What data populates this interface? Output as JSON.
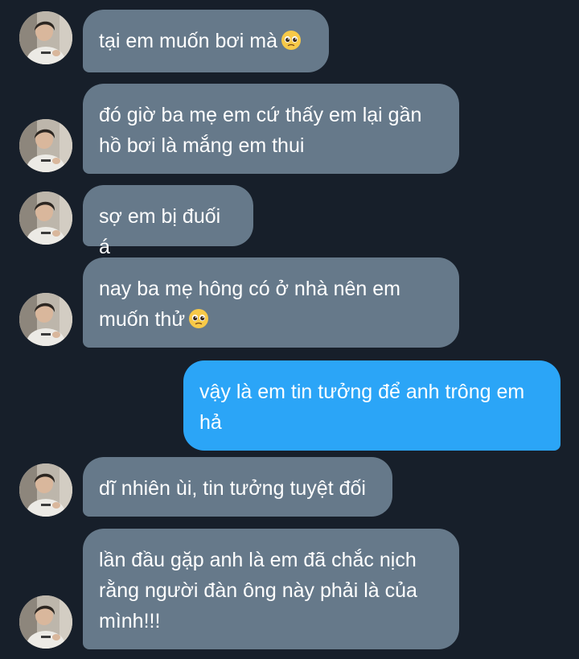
{
  "messages": [
    {
      "id": "m1",
      "direction": "incoming",
      "text": "tại em muốn bơi mà",
      "emoji": "pleading-face-emoji"
    },
    {
      "id": "m2",
      "direction": "incoming",
      "text": "đó giờ ba mẹ em cứ thấy em lại gần hồ bơi là mắng em thui"
    },
    {
      "id": "m3",
      "direction": "incoming",
      "text": "sợ em bị đuối á"
    },
    {
      "id": "m4",
      "direction": "incoming",
      "text": "nay ba mẹ hông có ở nhà nên em muốn thử",
      "emoji": "pleading-face-emoji"
    },
    {
      "id": "m5",
      "direction": "outgoing",
      "text": "vậy là em tin tưởng để anh trông em hả"
    },
    {
      "id": "m6",
      "direction": "incoming",
      "text": "dĩ nhiên ùi, tin tưởng tuyệt đối"
    },
    {
      "id": "m7",
      "direction": "incoming",
      "text": "lần đầu gặp anh là em đã chắc nịch rằng người đàn ông này phải là của mình!!!"
    }
  ],
  "colors": {
    "background": "#171f2a",
    "incoming_bubble": "#66798a",
    "outgoing_bubble": "#2ba5f7",
    "text": "#ffffff"
  },
  "icons": {
    "avatar": "contact-avatar-photo",
    "emoji": "pleading-face-emoji"
  }
}
